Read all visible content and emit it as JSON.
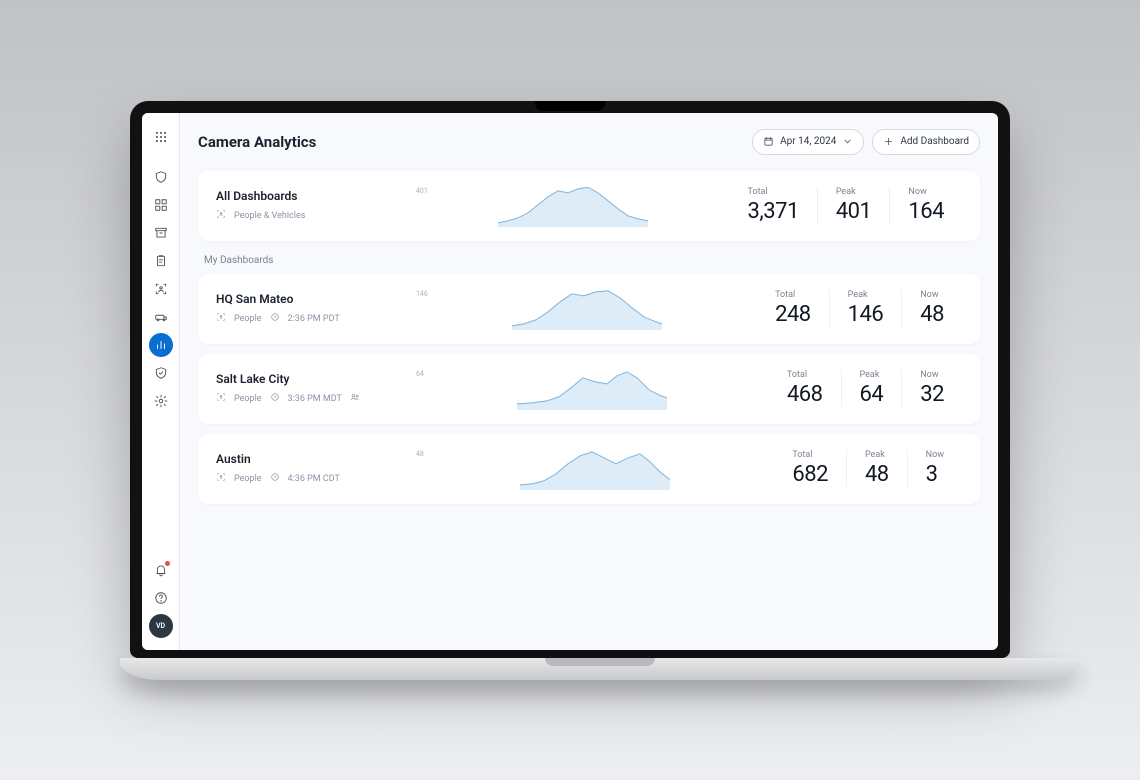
{
  "header": {
    "title": "Camera Analytics",
    "date": "Apr 14, 2024",
    "add_button": "Add Dashboard"
  },
  "sidebar": {
    "avatar_initials": "VD"
  },
  "labels": {
    "total": "Total",
    "peak": "Peak",
    "now": "Now",
    "my_dashboards": "My Dashboards"
  },
  "all": {
    "title": "All Dashboards",
    "subtitle": "People & Vehicles",
    "peak_label": "401",
    "total": "3,371",
    "peak": "401",
    "now": "164"
  },
  "dashboards": [
    {
      "title": "HQ San Mateo",
      "type": "People",
      "time": "2:36 PM PDT",
      "shared": false,
      "peak_label": "146",
      "total": "248",
      "peak": "146",
      "now": "48"
    },
    {
      "title": "Salt Lake City",
      "type": "People",
      "time": "3:36 PM MDT",
      "shared": true,
      "peak_label": "64",
      "total": "468",
      "peak": "64",
      "now": "32"
    },
    {
      "title": "Austin",
      "type": "People",
      "time": "4:36 PM CDT",
      "shared": false,
      "peak_label": "48",
      "total": "682",
      "peak": "48",
      "now": "3"
    }
  ],
  "chart_data": [
    {
      "name": "All Dashboards",
      "type": "area",
      "ylim": [
        0,
        401
      ],
      "values": [
        30,
        40,
        60,
        100,
        180,
        260,
        340,
        310,
        360,
        401,
        350,
        260,
        170,
        110,
        80,
        60,
        50
      ]
    },
    {
      "name": "HQ San Mateo",
      "type": "area",
      "ylim": [
        0,
        146
      ],
      "values": [
        10,
        15,
        25,
        45,
        75,
        110,
        140,
        128,
        135,
        146,
        130,
        100,
        70,
        48,
        35,
        28,
        22
      ]
    },
    {
      "name": "Salt Lake City",
      "type": "area",
      "ylim": [
        0,
        64
      ],
      "values": [
        8,
        9,
        11,
        14,
        20,
        32,
        48,
        60,
        55,
        50,
        58,
        64,
        58,
        45,
        35,
        30,
        26
      ]
    },
    {
      "name": "Austin",
      "type": "area",
      "ylim": [
        0,
        48
      ],
      "values": [
        4,
        5,
        7,
        12,
        22,
        34,
        44,
        48,
        42,
        34,
        40,
        45,
        38,
        28,
        20,
        14,
        10
      ]
    }
  ]
}
